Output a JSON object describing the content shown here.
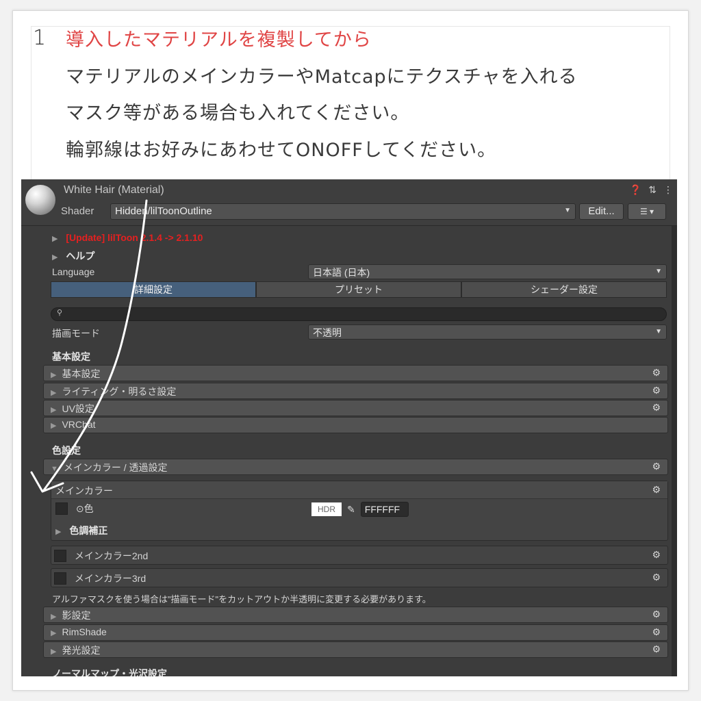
{
  "instructions": {
    "step_number": "1",
    "line1": "導入したマテリアルを複製してから",
    "line2": "マテリアルのメインカラーやMatcapにテクスチャを入れる",
    "line3": "マスク等がある場合も入れてください。",
    "line4": "輪郭線はお好みにあわせてONOFFしてください。"
  },
  "inspector": {
    "title": "White Hair (Material)",
    "header_icons": [
      "❓",
      "⇅",
      "⋮"
    ],
    "shader_label": "Shader",
    "shader_value": "Hidden/lilToonOutline",
    "edit_button": "Edit...",
    "menu_button": "☰ ▾",
    "update_notice": "[Update] lilToon 2.1.4 -> 2.1.10",
    "help_label": "ヘルプ",
    "language_label": "Language",
    "language_value": "日本語 (日本)",
    "tabs": [
      "詳細設定",
      "プリセット",
      "シェーダー設定"
    ],
    "search_icon": "🔍",
    "render_mode_label": "描画モード",
    "render_mode_value": "不透明",
    "basic_section": "基本設定",
    "basic_items": [
      "基本設定",
      "ライティング・明るさ設定",
      "UV設定",
      "VRChat"
    ],
    "color_section": "色設定",
    "main_color_fold": "メインカラー / 透過設定",
    "main_color_box_title": "メインカラー",
    "color_label": "⊙色",
    "hdr_label": "HDR",
    "hex_value": "FFFFFF",
    "color_adjust_label": "色調補正",
    "main_color_2nd": "メインカラー2nd",
    "main_color_3rd": "メインカラー3rd",
    "alpha_note": "アルファマスクを使う場合は\"描画モード\"をカットアウトか半透明に変更する必要があります。",
    "more_items": [
      "影設定",
      "RimShade",
      "発光設定"
    ],
    "normal_section": "ノーマルマップ・光沢設定"
  },
  "colors": {
    "instruction_red": "#e04545",
    "inspector_bg": "#3c3c3c",
    "active_tab": "#46607c",
    "update_red": "#e52020"
  }
}
